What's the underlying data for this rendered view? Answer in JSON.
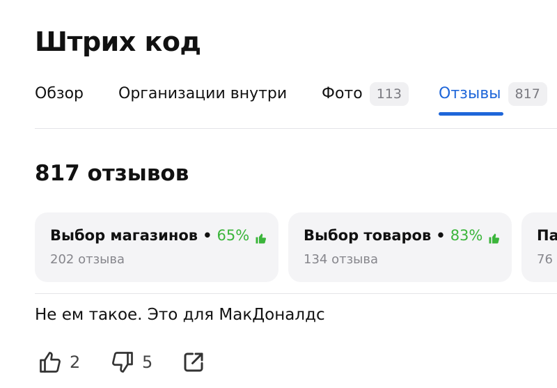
{
  "place": {
    "title": "Штрих код"
  },
  "tabs": [
    {
      "label": "Обзор",
      "count": null
    },
    {
      "label": "Организации внутри",
      "count": null
    },
    {
      "label": "Фото",
      "count": "113"
    },
    {
      "label": "Отзывы",
      "count": "817",
      "active": true
    }
  ],
  "reviews": {
    "heading": "817 отзывов",
    "aspects": [
      {
        "label": "Выбор магазинов",
        "percent": "65%",
        "count_text": "202 отзыва"
      },
      {
        "label": "Выбор товаров",
        "percent": "83%",
        "count_text": "134 отзыва"
      },
      {
        "label": "Па",
        "percent": "",
        "count_text": "76 о"
      }
    ],
    "review": {
      "text": "Не ем такое. Это для МакДоналдс",
      "likes": "2",
      "dislikes": "5"
    }
  },
  "colors": {
    "accent": "#1e66d9",
    "positive": "#3bb53b",
    "card_bg": "#f4f4f6",
    "muted_text": "#86868c"
  },
  "icons": {
    "thumb_up_filled": "thumb-up-filled-icon",
    "like": "thumb-up-outline-icon",
    "dislike": "thumb-down-outline-icon",
    "share": "share-external-icon"
  }
}
